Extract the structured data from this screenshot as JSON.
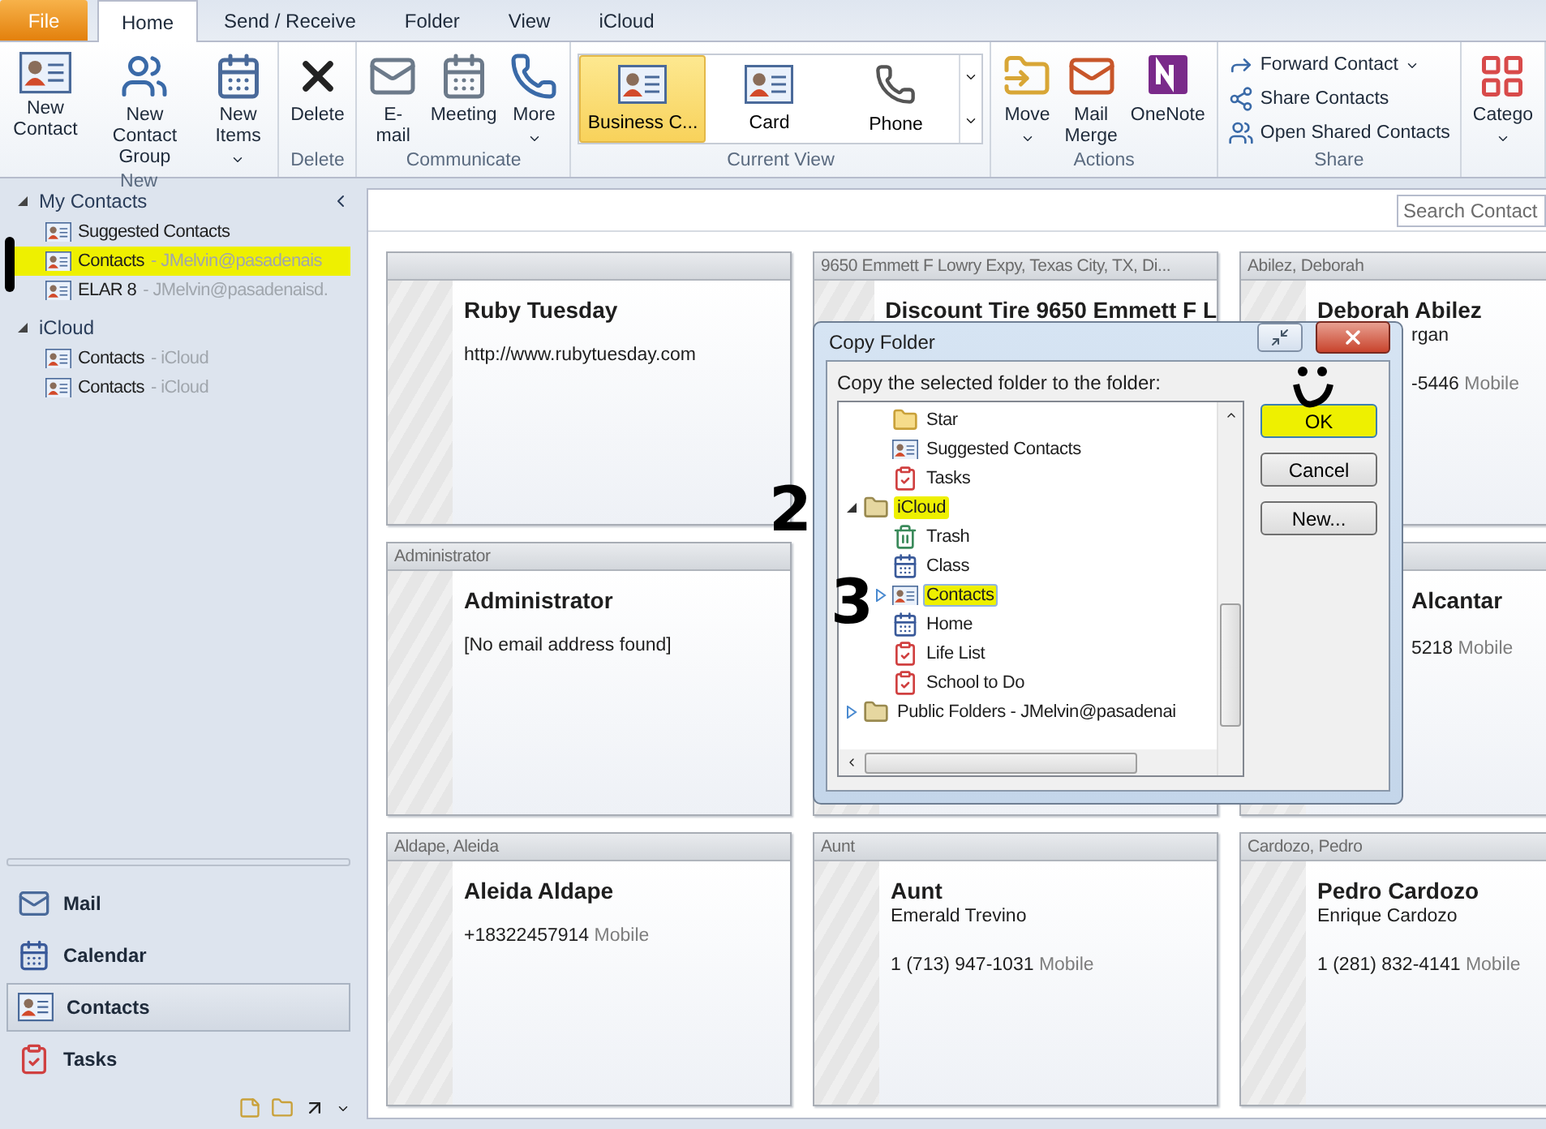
{
  "ribbon_tabs": [
    {
      "label": "File",
      "kind": "file",
      "selected": false
    },
    {
      "label": "Home",
      "kind": "tab",
      "selected": true
    },
    {
      "label": "Send / Receive",
      "kind": "tab",
      "selected": false
    },
    {
      "label": "Folder",
      "kind": "tab",
      "selected": false
    },
    {
      "label": "View",
      "kind": "tab",
      "selected": false
    },
    {
      "label": "iCloud",
      "kind": "tab",
      "selected": false
    }
  ],
  "ribbon_groups": [
    {
      "label": "New",
      "kind": "large",
      "buttons": [
        {
          "label": "New Contact",
          "dropdown": false
        },
        {
          "label": "New Contact Group",
          "dropdown": false
        },
        {
          "label": "New Items",
          "dropdown": true
        }
      ]
    },
    {
      "label": "Delete",
      "kind": "large",
      "buttons": [
        {
          "label": "Delete",
          "dropdown": false
        }
      ]
    },
    {
      "label": "Communicate",
      "kind": "large",
      "buttons": [
        {
          "label": "E-mail",
          "dropdown": false
        },
        {
          "label": "Meeting",
          "dropdown": false
        },
        {
          "label": "More",
          "dropdown": true
        }
      ]
    },
    {
      "label": "Current View",
      "kind": "gallery",
      "buttons": [
        {
          "label": "Business C...",
          "selected": true
        },
        {
          "label": "Card",
          "selected": false
        },
        {
          "label": "Phone",
          "selected": false
        }
      ]
    },
    {
      "label": "Actions",
      "kind": "large",
      "buttons": [
        {
          "label": "Move",
          "dropdown": true
        },
        {
          "label": "Mail Merge",
          "dropdown": false
        },
        {
          "label": "OneNote",
          "dropdown": false
        }
      ]
    },
    {
      "label": "Share",
      "kind": "small",
      "buttons": [
        {
          "label": "Forward Contact",
          "dropdown": true
        },
        {
          "label": "Share Contacts",
          "dropdown": false
        },
        {
          "label": "Open Shared Contacts",
          "dropdown": false
        }
      ]
    },
    {
      "kind": "large",
      "buttons": [
        {
          "label": "Catego",
          "dropdown": true
        }
      ]
    }
  ],
  "folder_pane": {
    "sections": [
      {
        "label": "My Contacts",
        "expanded": true,
        "items": [
          {
            "name": "Suggested Contacts",
            "selected": false,
            "highlighted": false
          },
          {
            "name": "Contacts",
            "account": "- JMelvin@pasadenais",
            "selected": true,
            "highlighted": true
          },
          {
            "name": "ELAR 8",
            "account": "- JMelvin@pasadenaisd.",
            "selected": false,
            "highlighted": false
          }
        ]
      },
      {
        "label": "iCloud",
        "expanded": true,
        "items": [
          {
            "name": "Contacts",
            "account": "- iCloud",
            "selected": false,
            "highlighted": false
          },
          {
            "name": "Contacts",
            "account": "- iCloud",
            "selected": false,
            "highlighted": false
          }
        ]
      }
    ]
  },
  "nav_buttons": [
    {
      "label": "Mail",
      "selected": false
    },
    {
      "label": "Calendar",
      "selected": false
    },
    {
      "label": "Contacts",
      "selected": true
    },
    {
      "label": "Tasks",
      "selected": false
    }
  ],
  "search": {
    "placeholder": "Search Contact"
  },
  "cards": [
    {
      "name": "Ruby Tuesday",
      "lines": [
        {
          "kind": "text",
          "text": "http://www.rubytuesday.com"
        }
      ]
    },
    {
      "header": "9650 Emmett F Lowry Expy, Texas City, TX, Di...",
      "name": "Discount Tire 9650 Emmett F L"
    },
    {
      "header": "Abilez, Deborah",
      "name": "Deborah Abilez",
      "lines": [
        {
          "kind": "company",
          "text": "rgan"
        },
        {
          "kind": "phone",
          "text": "-5446",
          "label": "Mobile"
        }
      ]
    },
    {
      "header": "Administrator",
      "name": "Administrator",
      "lines": [
        {
          "kind": "text",
          "text": "[No email address found]"
        }
      ]
    },
    {
      "kind": "covered"
    },
    {
      "name": "Alcantar",
      "lines": [
        {
          "kind": "phone",
          "text": "5218",
          "label": "Mobile"
        }
      ]
    },
    {
      "header": "Aldape, Aleida",
      "name": "Aleida Aldape",
      "lines": [
        {
          "kind": "text",
          "text": "+18322457914",
          "label": "Mobile"
        }
      ]
    },
    {
      "header": "Aunt",
      "name": "Aunt",
      "lines": [
        {
          "kind": "company",
          "text": "Emerald Trevino"
        },
        {
          "kind": "phone",
          "text": "1 (713) 947-1031",
          "label": "Mobile"
        }
      ]
    },
    {
      "header": "Cardozo, Pedro",
      "name": "Pedro Cardozo",
      "lines": [
        {
          "kind": "company",
          "text": "Enrique Cardozo"
        },
        {
          "kind": "phone",
          "text": "1 (281) 832-4141",
          "label": "Mobile"
        }
      ]
    }
  ],
  "dialog": {
    "title": "Copy Folder",
    "prompt": "Copy the selected folder to the folder:",
    "tree": [
      {
        "children": [
          {
            "name": "Star",
            "kind": "folder",
            "selected": false,
            "highlighted": false
          },
          {
            "name": "Suggested Contacts",
            "kind": "contacts",
            "selected": false,
            "highlighted": false
          },
          {
            "name": "Tasks",
            "kind": "tasks",
            "selected": false,
            "highlighted": false
          }
        ]
      },
      {
        "name": "iCloud",
        "kind": "store",
        "expanded": true,
        "selected": false,
        "highlighted": true,
        "children": [
          {
            "name": "Trash",
            "kind": "trash",
            "selected": false,
            "highlighted": false
          },
          {
            "name": "Class",
            "kind": "calendar",
            "selected": false,
            "highlighted": false
          },
          {
            "name": "Contacts",
            "kind": "contacts",
            "expanded": false,
            "selected": true,
            "highlighted": true
          },
          {
            "name": "Home",
            "kind": "calendar",
            "selected": false,
            "highlighted": false
          },
          {
            "name": "Life List",
            "kind": "tasks",
            "selected": false,
            "highlighted": false
          },
          {
            "name": "School to Do",
            "kind": "tasks",
            "selected": false,
            "highlighted": false
          }
        ]
      },
      {
        "name": "Public Folders - JMelvin@pasadenai",
        "kind": "store",
        "expanded": false,
        "selected": false,
        "highlighted": false
      }
    ],
    "buttons": [
      {
        "label": "OK",
        "highlighted": true
      },
      {
        "label": "Cancel",
        "highlighted": false
      },
      {
        "label": "New...",
        "highlighted": false
      }
    ]
  },
  "annotations": [
    "2",
    "3"
  ]
}
